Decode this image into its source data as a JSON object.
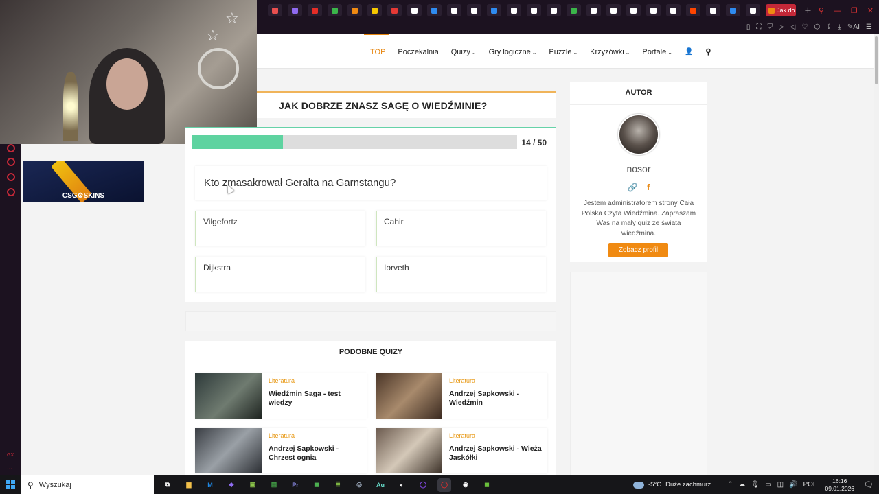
{
  "browser": {
    "tabs": [
      {
        "icon": "cube-icon",
        "color": "#e94f4f"
      },
      {
        "icon": "gamepad-icon",
        "color": "#8f6af0"
      },
      {
        "icon": "youtube-icon",
        "color": "#e52d27"
      },
      {
        "icon": "w-icon",
        "color": "#3bb54a"
      },
      {
        "icon": "tile-icon",
        "color": "#f08a12"
      },
      {
        "icon": "arrow-icon",
        "color": "#f6c700"
      },
      {
        "icon": "u-icon",
        "color": "#e53935"
      },
      {
        "icon": "x-icon",
        "color": "#ffffff"
      },
      {
        "icon": "go-icon",
        "color": "#2f8bf0"
      },
      {
        "icon": "tiktok-icon",
        "color": "#ffffff"
      },
      {
        "icon": "x-icon",
        "color": "#ffffff"
      },
      {
        "icon": "go-icon",
        "color": "#2f8bf0"
      },
      {
        "icon": "x-icon",
        "color": "#ffffff"
      },
      {
        "icon": "x-icon",
        "color": "#ffffff"
      },
      {
        "icon": "openai-icon",
        "color": "#ffffff"
      },
      {
        "icon": "sheet-icon",
        "color": "#3bb54a"
      },
      {
        "icon": "x-icon",
        "color": "#ffffff"
      },
      {
        "icon": "shield-icon",
        "color": "#ffffff"
      },
      {
        "icon": "x-icon",
        "color": "#ffffff"
      },
      {
        "icon": "google-icon",
        "color": "#ffffff"
      },
      {
        "icon": "crosshair-icon",
        "color": "#ffffff"
      },
      {
        "icon": "reddit-icon",
        "color": "#ff4500"
      },
      {
        "icon": "google-icon",
        "color": "#ffffff"
      },
      {
        "icon": "mail-icon",
        "color": "#2f8bf0"
      },
      {
        "icon": "google-icon",
        "color": "#ffffff"
      }
    ],
    "active_tab_label": "Jak do",
    "new_tab": "+",
    "accent": "#c32838"
  },
  "site_nav": {
    "items": [
      {
        "label": "TOP",
        "chevron": false
      },
      {
        "label": "Poczekalnia",
        "chevron": false
      },
      {
        "label": "Quizy",
        "chevron": true
      },
      {
        "label": "Gry logiczne",
        "chevron": true
      },
      {
        "label": "Puzzle",
        "chevron": true
      },
      {
        "label": "Krzyżówki",
        "chevron": true
      },
      {
        "label": "Portale",
        "chevron": true
      }
    ],
    "chevron": "⌄",
    "user_icon": "👤",
    "search_icon": "⚲",
    "accent": "#e7860f"
  },
  "quiz": {
    "title": "JAK DOBRZE ZNASZ SAGĘ O WIEDŹMINIE?",
    "progress": {
      "current": 14,
      "total": 50,
      "label": "14 / 50",
      "fraction": 0.28
    },
    "question": "Kto zmasakrował Geralta na Garnstangu?",
    "answers": [
      "Vilgefortz",
      "Cahir",
      "Dijkstra",
      "Iorveth"
    ]
  },
  "similar": {
    "heading": "PODOBNE QUIZY",
    "items": [
      {
        "category": "Literatura",
        "title": "Wiedźmin Saga - test wiedzy"
      },
      {
        "category": "Literatura",
        "title": "Andrzej Sapkowski - Wiedźmin"
      },
      {
        "category": "Literatura",
        "title": "Andrzej Sapkowski - Chrzest ognia"
      },
      {
        "category": "Literatura",
        "title": "Andrzej Sapkowski - Wieża Jaskółki"
      }
    ]
  },
  "author": {
    "heading": "AUTOR",
    "name": "nosor",
    "links": [
      "🔗",
      "f"
    ],
    "description": "Jestem administratorem strony Cała Polska Czyta Wiedźmina. Zapraszam Was na mały quiz ze świata wiedźmina.",
    "profile_button": "Zobacz profil"
  },
  "ad": {
    "brand": "CSG⚙SKINS"
  },
  "sidebar": {
    "label": "GX",
    "more": "···"
  },
  "taskbar": {
    "search_placeholder": "Wyszukaj",
    "apps": [
      {
        "name": "task-view-icon",
        "label": "⧉",
        "color": "#ffffff"
      },
      {
        "name": "explorer-icon",
        "label": "▆",
        "color": "#f2c04a"
      },
      {
        "name": "m-app-icon",
        "label": "M",
        "color": "#1e88e5"
      },
      {
        "name": "crystal-icon",
        "label": "◆",
        "color": "#8e6cf0"
      },
      {
        "name": "controller-icon",
        "label": "▣",
        "color": "#8bc34a"
      },
      {
        "name": "spreadsheet-icon",
        "label": "▤",
        "color": "#43a047"
      },
      {
        "name": "premiere-icon",
        "label": "Pr",
        "color": "#9999ff"
      },
      {
        "name": "cube-app-icon",
        "label": "◼",
        "color": "#4caf50"
      },
      {
        "name": "books-icon",
        "label": "≣",
        "color": "#7cb342"
      },
      {
        "name": "chrome-like-icon",
        "label": "◎",
        "color": "#a0aec0"
      },
      {
        "name": "audition-icon",
        "label": "Au",
        "color": "#66d9c8"
      },
      {
        "name": "steam-icon",
        "label": "◐",
        "color": "#ffffff"
      },
      {
        "name": "ring-app-icon",
        "label": "◯",
        "color": "#8a4cf0"
      },
      {
        "name": "opera-gx-icon",
        "label": "◯",
        "color": "#d32f2f"
      },
      {
        "name": "obs-icon",
        "label": "◉",
        "color": "#ffffff"
      },
      {
        "name": "minecraft-icon",
        "label": "◼",
        "color": "#6abf3c"
      }
    ],
    "weather_temp": "-5°C",
    "weather_text": "Duże zachmurz...",
    "language": "POL",
    "time": "16:16",
    "date": "09.01.2026"
  }
}
